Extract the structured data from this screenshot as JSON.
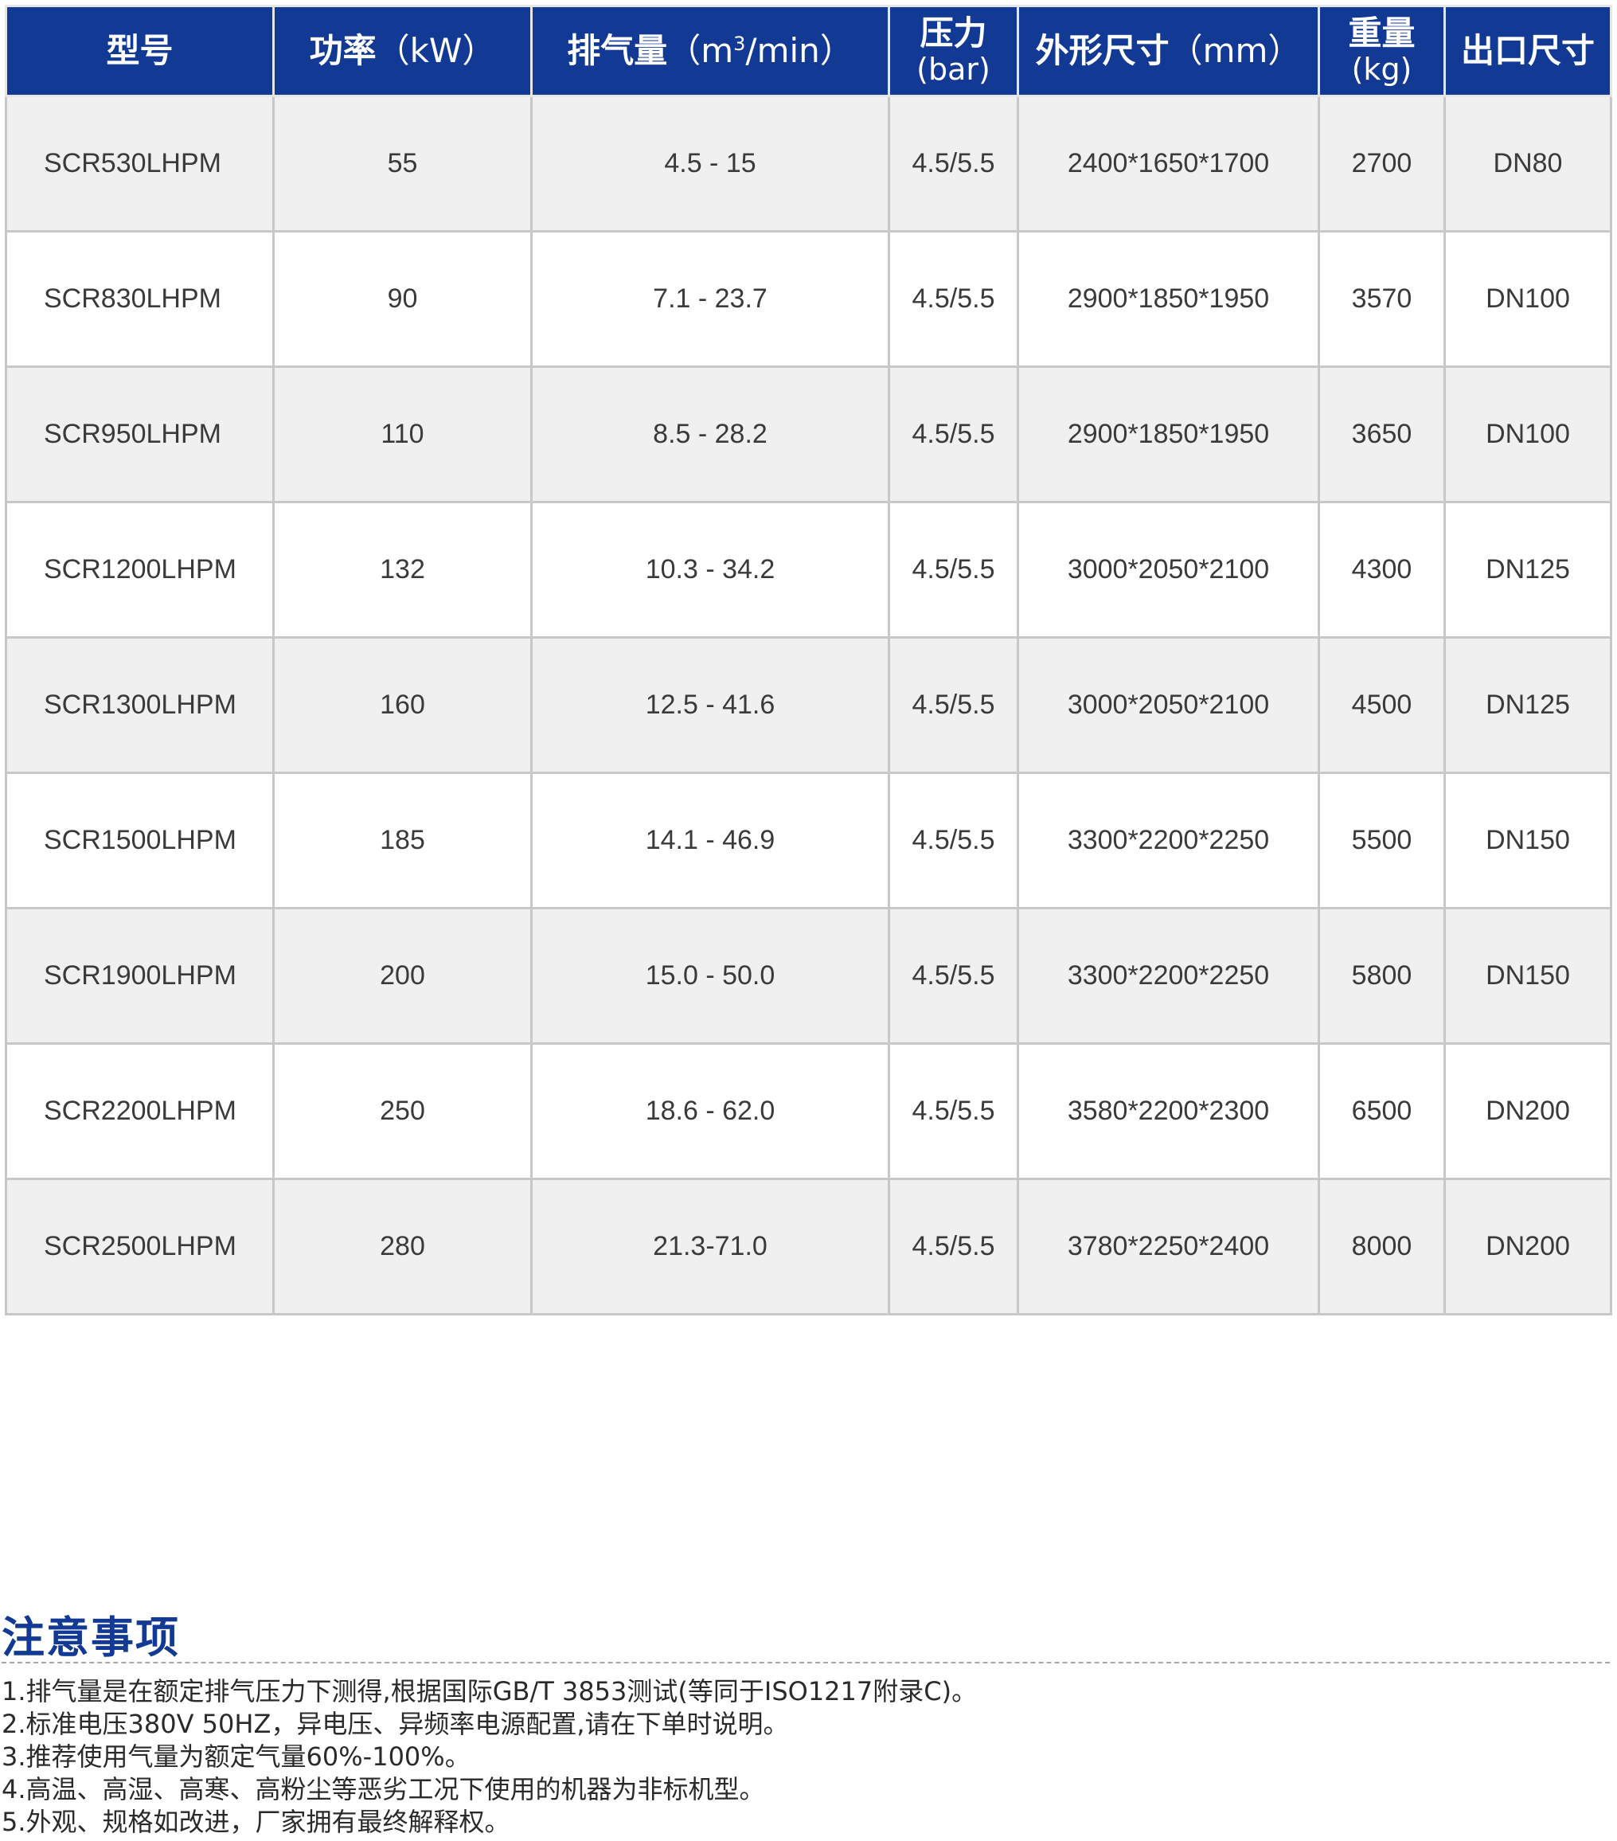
{
  "table": {
    "headers": {
      "model": "型号",
      "power_label": "功率",
      "power_unit": "（kW）",
      "flow_label": "排气量",
      "flow_unit_pre": "（m",
      "flow_unit_sup": "3",
      "flow_unit_post": "/min）",
      "pressure_label": "压力",
      "pressure_unit": "(bar)",
      "dimensions_label": "外形尺寸",
      "dimensions_unit": "（mm）",
      "weight_label": "重量",
      "weight_unit": "(kg)",
      "outlet": "出口尺寸"
    },
    "rows": [
      {
        "model": "SCR530LHPM",
        "power": "55",
        "flow": "4.5 - 15",
        "pressure": "4.5/5.5",
        "dimensions": "2400*1650*1700",
        "weight": "2700",
        "outlet": "DN80"
      },
      {
        "model": "SCR830LHPM",
        "power": "90",
        "flow": "7.1 - 23.7",
        "pressure": "4.5/5.5",
        "dimensions": "2900*1850*1950",
        "weight": "3570",
        "outlet": "DN100"
      },
      {
        "model": "SCR950LHPM",
        "power": "110",
        "flow": "8.5 - 28.2",
        "pressure": "4.5/5.5",
        "dimensions": "2900*1850*1950",
        "weight": "3650",
        "outlet": "DN100"
      },
      {
        "model": "SCR1200LHPM",
        "power": "132",
        "flow": "10.3 - 34.2",
        "pressure": "4.5/5.5",
        "dimensions": "3000*2050*2100",
        "weight": "4300",
        "outlet": "DN125"
      },
      {
        "model": "SCR1300LHPM",
        "power": "160",
        "flow": "12.5 - 41.6",
        "pressure": "4.5/5.5",
        "dimensions": "3000*2050*2100",
        "weight": "4500",
        "outlet": "DN125"
      },
      {
        "model": "SCR1500LHPM",
        "power": "185",
        "flow": "14.1 - 46.9",
        "pressure": "4.5/5.5",
        "dimensions": "3300*2200*2250",
        "weight": "5500",
        "outlet": "DN150"
      },
      {
        "model": "SCR1900LHPM",
        "power": "200",
        "flow": "15.0 - 50.0",
        "pressure": "4.5/5.5",
        "dimensions": "3300*2200*2250",
        "weight": "5800",
        "outlet": "DN150"
      },
      {
        "model": "SCR2200LHPM",
        "power": "250",
        "flow": "18.6 - 62.0",
        "pressure": "4.5/5.5",
        "dimensions": "3580*2200*2300",
        "weight": "6500",
        "outlet": "DN200"
      },
      {
        "model": "SCR2500LHPM",
        "power": "280",
        "flow": "21.3-71.0",
        "pressure": "4.5/5.5",
        "dimensions": "3780*2250*2400",
        "weight": "8000",
        "outlet": "DN200"
      }
    ]
  },
  "notes": {
    "heading": "注意事项",
    "items": [
      "1.排气量是在额定排气压力下测得,根据国际GB/T  3853测试(等同于ISO1217附录C)。",
      "2.标准电压380V 50HZ，异电压、异频率电源配置,请在下单时说明。",
      "3.推荐使用气量为额定气量60%-100%。",
      "4.高温、高湿、高寒、高粉尘等恶劣工况下使用的机器为非标机型。",
      "5.外观、规格如改进，厂家拥有最终解释权。"
    ]
  },
  "colors": {
    "header_bg": "#123a95",
    "header_text": "#ffffff",
    "row_shaded": "#f0f0f0",
    "row_plain": "#ffffff",
    "grid_line": "#c8c8c8",
    "notes_heading": "#123a95"
  }
}
